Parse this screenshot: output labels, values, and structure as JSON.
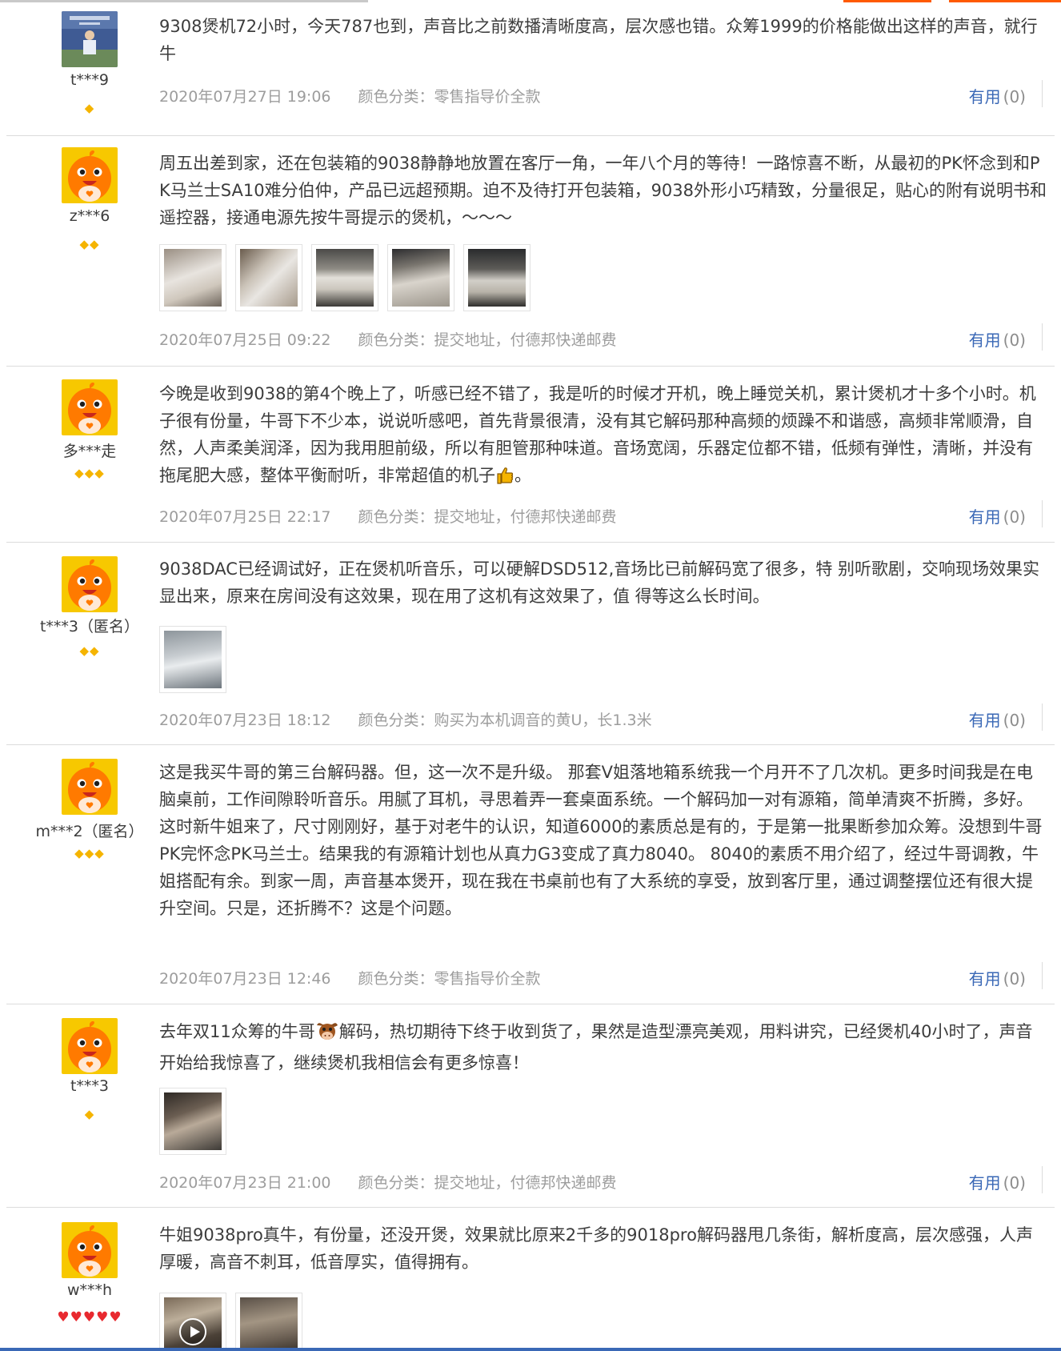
{
  "colors": {
    "accent": "#3a68b6",
    "meta_text": "#9d9d9d",
    "gem": "#f5b400",
    "heart": "#e8292f",
    "avatar_orange": "#ff7a00",
    "avatar_bg": "#f7c800"
  },
  "reviews": [
    {
      "user": "t***9",
      "level_icons": [
        "gem"
      ],
      "avatar": "photo-avatar",
      "text": "9308煲机72小时，今天787也到，声音比之前数播清晰度高，层次感也错。众筹1999的价格能做出这样的声音，就行牛",
      "images": [],
      "date": "2020年07月27日 19:06",
      "sku": "颜色分类：零售指导价全款",
      "useful_label": "有用",
      "useful_count": "(0)"
    },
    {
      "user": "z***6",
      "level_icons": [
        "gem",
        "gem"
      ],
      "avatar": "default-avatar",
      "text": "周五出差到家，还在包装箱的9038静静地放置在客厅一角，一年八个月的等待！一路惊喜不断，从最初的PK怀念到和PK马兰士SA10难分伯仲，产品已远超预期。迫不及待打开包装箱，9038外形小巧精致，分量很足，贴心的附有说明书和遥控器，接通电源先按牛哥提示的煲机，～～～",
      "images": [
        "box-photo",
        "unboxing-photo",
        "front-panel-photo",
        "top-view-photo",
        "rear-panel-photo"
      ],
      "date": "2020年07月25日 09:22",
      "sku": "颜色分类：提交地址，付德邦快递邮费",
      "useful_label": "有用",
      "useful_count": "(0)"
    },
    {
      "user": "多***走",
      "level_icons": [
        "gem",
        "gem",
        "gem"
      ],
      "avatar": "default-avatar",
      "text": "今晚是收到9038的第4个晚上了，听感已经不错了，我是听的时候才开机，晚上睡觉关机，累计煲机才十多个小时。机子很有份量，牛哥下不少本，说说听感吧，首先背景很清，没有其它解码那种高频的烦躁不和谐感，高频非常顺滑，自然，人声柔美润泽，因为我用胆前级，所以有胆管那种味道。音场宽阔，乐器定位都不错，低频有弹性，清晰，并没有拖尾肥大感，整体平衡耐听，非常超值的机子",
      "text_tail": "。",
      "images": [],
      "date": "2020年07月25日 22:17",
      "sku": "颜色分类：提交地址，付德邦快递邮费",
      "useful_label": "有用",
      "useful_count": "(0)"
    },
    {
      "user": "t***3（匿名）",
      "level_icons": [
        "gem",
        "gem"
      ],
      "avatar": "default-avatar",
      "text": "9038DAC已经调试好，正在煲机听音乐，可以硬解DSD512,音场比已前解码宽了很多，特 别听歌剧，交响现场效果实显出来，原来在房间没有这效果，现在用了这机有这效果了，值 得等这么长时间。",
      "images": [
        "device-photo"
      ],
      "date": "2020年07月23日 18:12",
      "sku": "颜色分类：购买为本机调音的黄U，长1.3米",
      "useful_label": "有用",
      "useful_count": "(0)"
    },
    {
      "user": "m***2（匿名）",
      "level_icons": [
        "gem",
        "gem",
        "gem"
      ],
      "avatar": "default-avatar",
      "text": "这是我买牛哥的第三台解码器。但，这一次不是升级。 那套V姐落地箱系统我一个月开不了几次机。更多时间我是在电脑桌前，工作间隙聆听音乐。用腻了耳机，寻思着弄一套桌面系统。一个解码加一对有源箱，简单清爽不折腾，多好。 这时新牛姐来了，尺寸刚刚好，基于对老牛的认识，知道6000的素质总是有的，于是第一批果断参加众筹。没想到牛哥PK完怀念PK马兰士。结果我的有源箱计划也从真力G3变成了真力8040。 8040的素质不用介绍了，经过牛哥调教，牛姐搭配有余。到家一周，声音基本煲开，现在我在书桌前也有了大系统的享受，放到客厅里，通过调整摆位还有很大提升空间。只是，还折腾不？这是个问题。",
      "images": [],
      "date": "2020年07月23日 12:46",
      "sku": "颜色分类：零售指导价全款",
      "useful_label": "有用",
      "useful_count": "(0)"
    },
    {
      "user": "t***3",
      "level_icons": [
        "gem"
      ],
      "avatar": "default-avatar",
      "text_head": "去年双11众筹的牛哥",
      "text": "解码，热切期待下终于收到货了，果然是造型漂亮美观，用料讲究，已经煲机40小时了，声音开始给我惊喜了，继续煲机我相信会有更多惊喜！",
      "images": [
        "desk-setup-photo"
      ],
      "date": "2020年07月23日 21:00",
      "sku": "颜色分类：提交地址，付德邦快递邮费",
      "useful_label": "有用",
      "useful_count": "(0)"
    },
    {
      "user": "w***h",
      "level_icons": [
        "heart",
        "heart",
        "heart",
        "heart",
        "heart"
      ],
      "avatar": "default-avatar",
      "text": "牛姐9038pro真牛，有份量，还没开煲，效果就比原来2千多的9018pro解码器甩几条街，解析度高，层次感强，人声厚暖，高音不刺耳，低音厚实，值得拥有。",
      "images": [
        "video-thumbnail",
        "rack-photo"
      ],
      "date": "",
      "sku": "",
      "useful_label": "",
      "useful_count": ""
    }
  ]
}
